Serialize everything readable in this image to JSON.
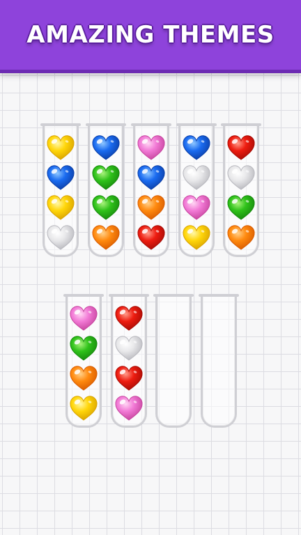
{
  "banner": {
    "title": "AMAZING THEMES"
  },
  "colors": {
    "yellow": [
      "#fff7a8",
      "#ffd60a",
      "#d9a300"
    ],
    "blue": [
      "#8fc7ff",
      "#1a6bf0",
      "#0b3fa8"
    ],
    "green": [
      "#a9f27c",
      "#2fc21a",
      "#178a0d"
    ],
    "white": [
      "#ffffff",
      "#e8e8ea",
      "#b9b9bf"
    ],
    "pink": [
      "#ffd6f3",
      "#f27ad6",
      "#c7459f"
    ],
    "orange": [
      "#ffd08a",
      "#ff8a0f",
      "#d95c00"
    ],
    "red": [
      "#ff9b8a",
      "#ee1c10",
      "#a80c05"
    ]
  },
  "tubes": [
    {
      "balls": [
        "yellow",
        "blue",
        "yellow",
        "white"
      ]
    },
    {
      "balls": [
        "blue",
        "green",
        "green",
        "orange"
      ]
    },
    {
      "balls": [
        "pink",
        "blue",
        "orange",
        "red"
      ]
    },
    {
      "balls": [
        "blue",
        "white",
        "pink",
        "yellow"
      ]
    },
    {
      "balls": [
        "red",
        "white",
        "green",
        "orange"
      ]
    },
    {
      "balls": [
        "pink",
        "green",
        "orange",
        "yellow"
      ]
    },
    {
      "balls": [
        "red",
        "white",
        "red",
        "pink"
      ]
    },
    {
      "balls": []
    },
    {
      "balls": []
    }
  ]
}
